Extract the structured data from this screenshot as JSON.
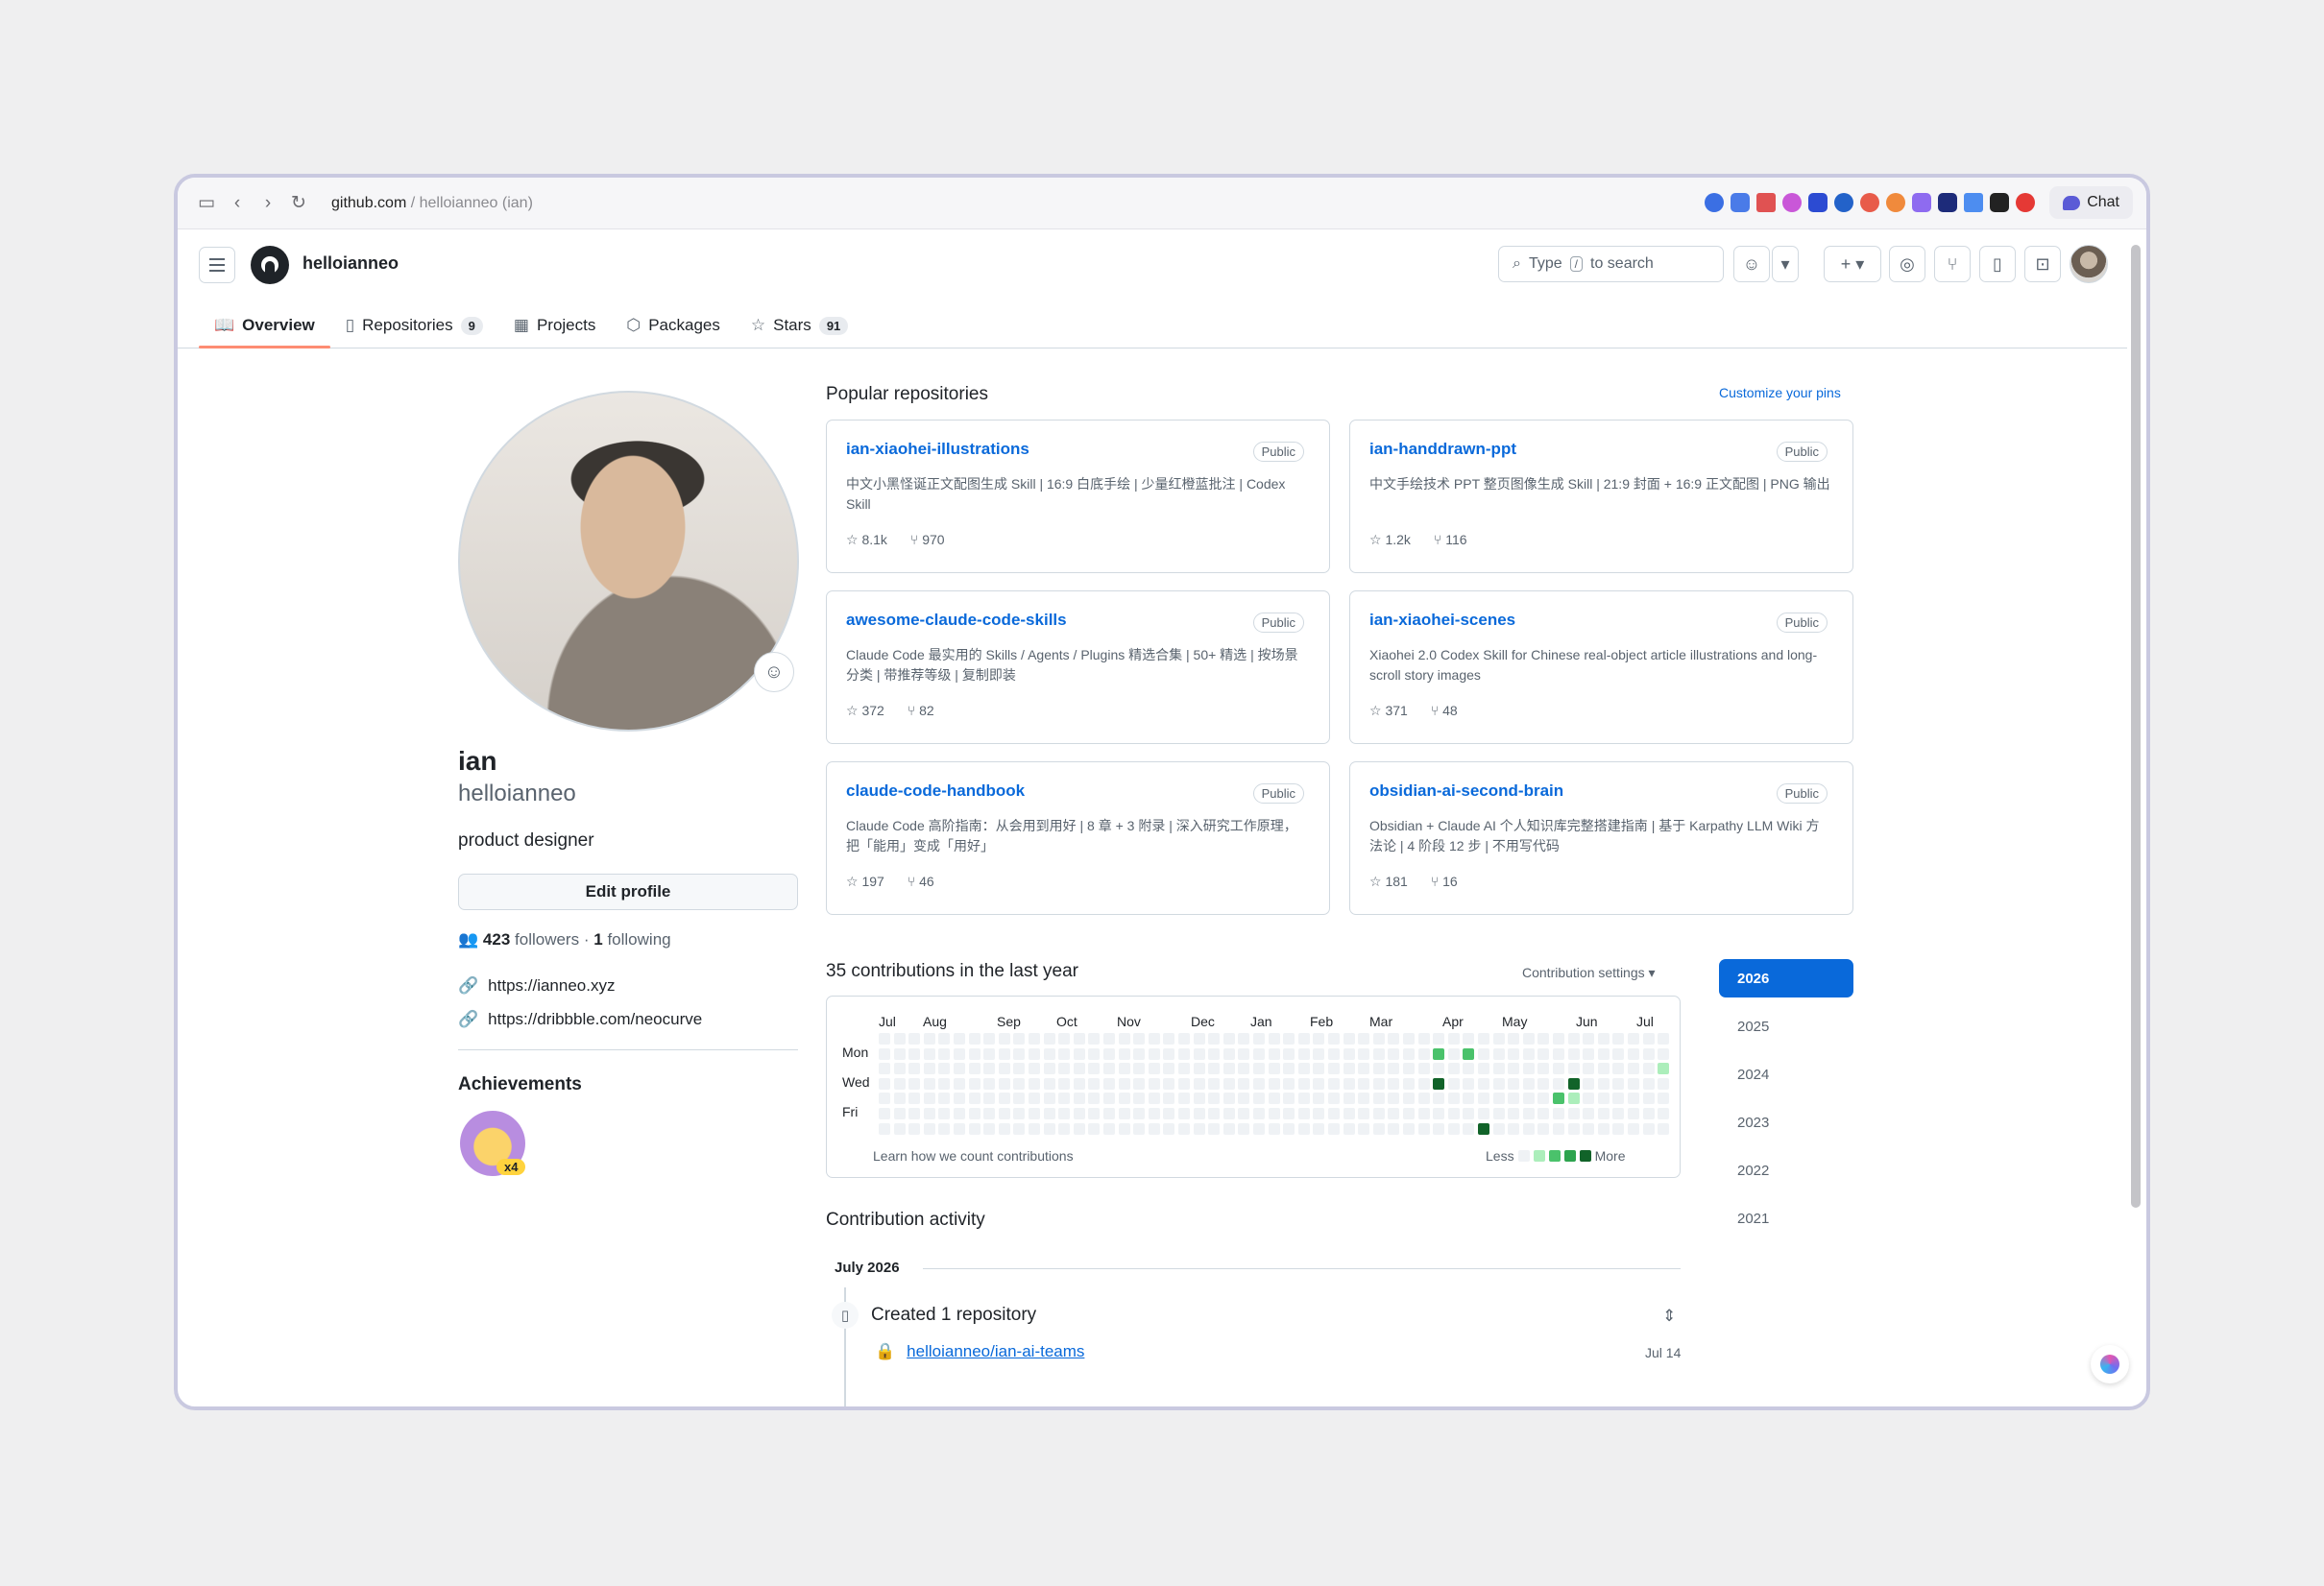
{
  "browser": {
    "url_host": "github.com",
    "url_rest": " / helloianneo (ian)",
    "chat_label": "Chat"
  },
  "header": {
    "username": "helloianneo",
    "search_type": "Type",
    "search_slash": "/",
    "search_rest": "to search"
  },
  "tabs": [
    {
      "label": "Overview",
      "icon": "book-icon"
    },
    {
      "label": "Repositories",
      "count": "9",
      "icon": "repo-icon"
    },
    {
      "label": "Projects",
      "icon": "table-icon"
    },
    {
      "label": "Packages",
      "icon": "package-icon"
    },
    {
      "label": "Stars",
      "count": "91",
      "icon": "star-icon"
    }
  ],
  "profile": {
    "name": "ian",
    "login": "helloianneo",
    "bio": "product designer",
    "edit_label": "Edit profile",
    "followers": "423",
    "followers_label": "followers",
    "dot": "·",
    "following": "1",
    "following_label": "following",
    "links": [
      "https://ianneo.xyz",
      "https://dribbble.com/neocurve"
    ],
    "achievements_title": "Achievements",
    "badge_count": "x4"
  },
  "pinned": {
    "title": "Popular repositories",
    "customize": "Customize your pins",
    "repos": [
      {
        "name": "ian-xiaohei-illustrations",
        "visibility": "Public",
        "desc": "中文小黑怪诞正文配图生成 Skill | 16:9 白底手绘 | 少量红橙蓝批注 | Codex Skill",
        "stars": "8.1k",
        "forks": "970"
      },
      {
        "name": "ian-handdrawn-ppt",
        "visibility": "Public",
        "desc": "中文手绘技术 PPT 整页图像生成 Skill | 21:9 封面 + 16:9 正文配图 | PNG 输出",
        "stars": "1.2k",
        "forks": "116"
      },
      {
        "name": "awesome-claude-code-skills",
        "visibility": "Public",
        "desc": "Claude Code 最实用的 Skills / Agents / Plugins 精选合集 | 50+ 精选 | 按场景分类 | 带推荐等级 | 复制即装",
        "stars": "372",
        "forks": "82"
      },
      {
        "name": "ian-xiaohei-scenes",
        "visibility": "Public",
        "desc": "Xiaohei 2.0 Codex Skill for Chinese real-object article illustrations and long-scroll story images",
        "stars": "371",
        "forks": "48"
      },
      {
        "name": "claude-code-handbook",
        "visibility": "Public",
        "desc": "Claude Code 高阶指南：从会用到用好 | 8 章 + 3 附录 | 深入研究工作原理，把「能用」变成「用好」",
        "stars": "197",
        "forks": "46"
      },
      {
        "name": "obsidian-ai-second-brain",
        "visibility": "Public",
        "desc": "Obsidian + Claude AI 个人知识库完整搭建指南 | 基于 Karpathy LLM Wiki 方法论 | 4 阶段 12 步 | 不用写代码",
        "stars": "181",
        "forks": "16"
      }
    ]
  },
  "contributions": {
    "title": "35 contributions in the last year",
    "settings": "Contribution settings",
    "months": [
      "Jul",
      "Aug",
      "Sep",
      "Oct",
      "Nov",
      "Dec",
      "Jan",
      "Feb",
      "Mar",
      "Apr",
      "May",
      "Jun",
      "Jul"
    ],
    "days": [
      "Mon",
      "Wed",
      "Fri"
    ],
    "learn": "Learn how we count contributions",
    "less": "Less",
    "more": "More",
    "colors": [
      "#eff2f5",
      "#aceebb",
      "#4ac26b",
      "#2da44e",
      "#116329"
    ],
    "levels": [
      {
        "week": 37,
        "day": 1,
        "level": 2
      },
      {
        "week": 39,
        "day": 1,
        "level": 2
      },
      {
        "week": 37,
        "day": 3,
        "level": 4
      },
      {
        "week": 40,
        "day": 6,
        "level": 4
      },
      {
        "week": 46,
        "day": 3,
        "level": 4
      },
      {
        "week": 45,
        "day": 4,
        "level": 2
      },
      {
        "week": 46,
        "day": 4,
        "level": 1
      },
      {
        "week": 52,
        "day": 2,
        "level": 1
      }
    ]
  },
  "years": [
    "2026",
    "2025",
    "2024",
    "2023",
    "2022",
    "2021"
  ],
  "activity": {
    "title": "Contribution activity",
    "month": "July 2026",
    "event": "Created 1 repository",
    "repo": "helloianneo/ian-ai-teams",
    "date": "Jul 14"
  }
}
